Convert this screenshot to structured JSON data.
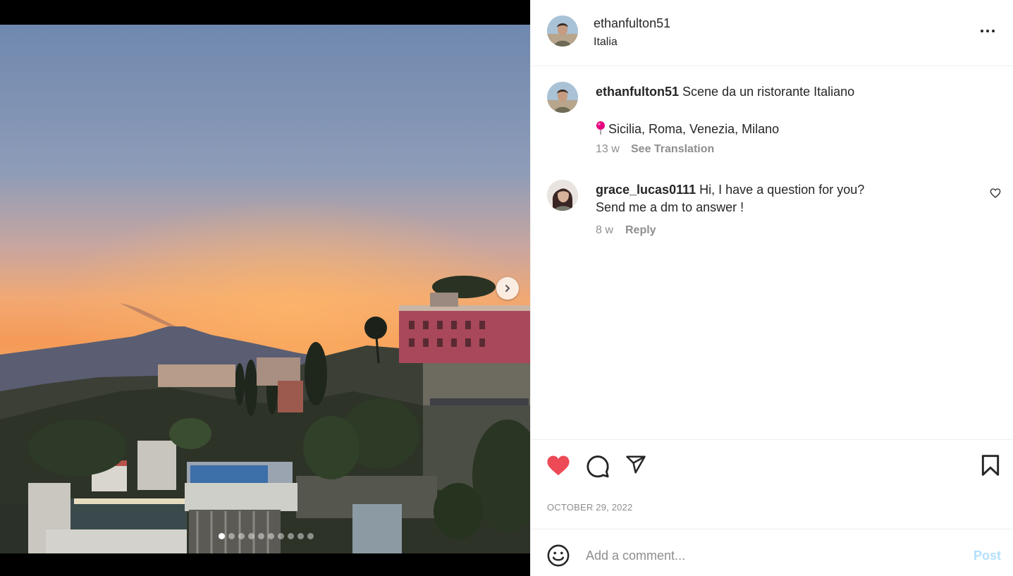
{
  "media": {
    "carousel_count": 10,
    "active_index": 0
  },
  "post": {
    "username": "ethanfulton51",
    "location": "Italia",
    "caption": {
      "username": "ethanfulton51",
      "text": "Scene da un ristorante Italiano",
      "second_line": "Sicilia, Roma, Venezia, Milano",
      "pin_icon": "round-pushpin-icon",
      "age": "13 w",
      "translate_label": "See Translation"
    },
    "comments": [
      {
        "username": "grace_lucas0111",
        "text_line1": "Hi, I have a question for you?",
        "text_line2": "Send me a dm to answer !",
        "age": "8 w",
        "reply_label": "Reply"
      }
    ],
    "date": "OCTOBER 29, 2022",
    "liked": true,
    "like_color": "#ed4956"
  },
  "add_comment": {
    "placeholder": "Add a comment...",
    "post_label": "Post",
    "post_color": "#b2dffc"
  }
}
